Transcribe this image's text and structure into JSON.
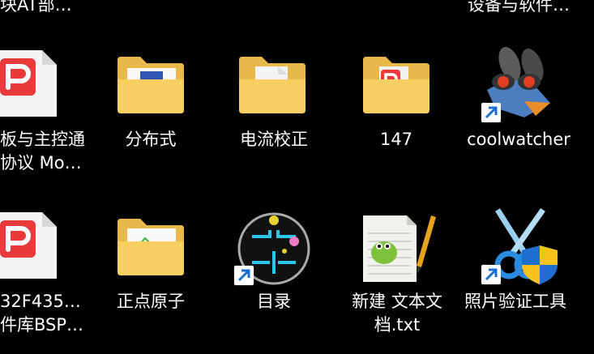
{
  "desktop": {
    "top_labels": [
      "块AT部…",
      "设备与软件…"
    ],
    "items": [
      {
        "name": "file-pdf-1",
        "label": "板与主控通\n协议 Mo…"
      },
      {
        "name": "folder-fenbushi",
        "label": "分布式"
      },
      {
        "name": "folder-dianliu",
        "label": "电流校正"
      },
      {
        "name": "folder-147",
        "label": "147"
      },
      {
        "name": "shortcut-coolwatcher",
        "label": "coolwatcher"
      },
      {
        "name": "file-pdf-2",
        "label": "32F435…\n件库BSP…"
      },
      {
        "name": "folder-zhengdian",
        "label": "正点原子"
      },
      {
        "name": "shortcut-mulu",
        "label": "目录"
      },
      {
        "name": "file-txt-new",
        "label": "新建 文本文\n档.txt"
      },
      {
        "name": "shortcut-photo-verify",
        "label": "照片验证工具"
      }
    ]
  }
}
